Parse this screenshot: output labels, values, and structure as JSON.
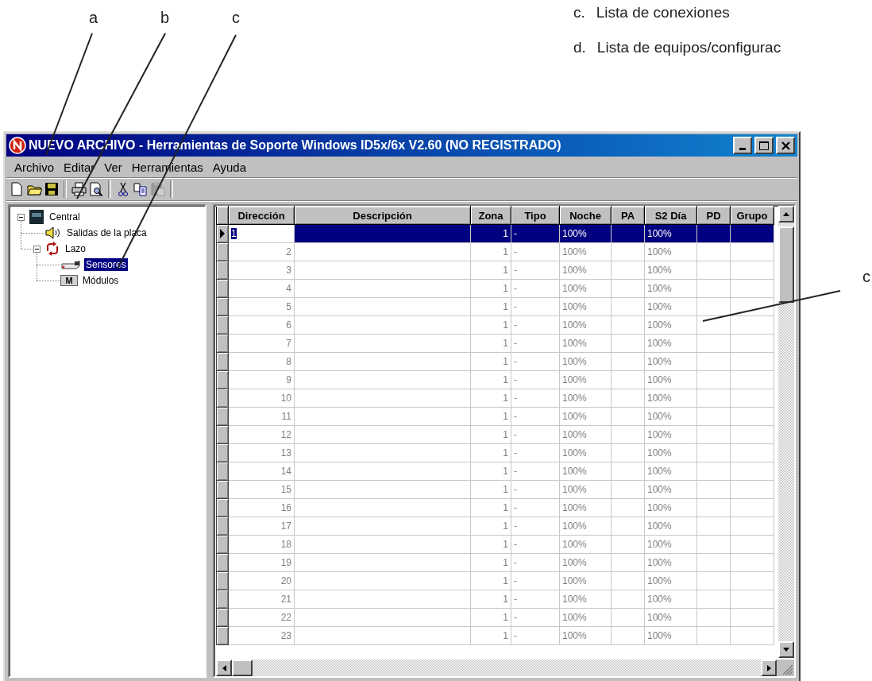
{
  "callouts": [
    {
      "letter": "a"
    },
    {
      "letter": "b"
    },
    {
      "letter": "c"
    }
  ],
  "legend": [
    {
      "letter": "c.",
      "text": "Lista de conexiones"
    },
    {
      "letter": "d.",
      "text": "Lista de equipos/configurac"
    }
  ],
  "side_callout": "c",
  "window": {
    "title": "NUEVO ARCHIVO - Herramientas de Soporte Windows ID5x/6x V2.60 (NO REGISTRADO)"
  },
  "menu": [
    "Archivo",
    "Editar",
    "Ver",
    "Herramientas",
    "Ayuda"
  ],
  "toolbar": [
    {
      "disabled": false
    },
    {
      "disabled": false
    },
    {
      "disabled": false
    },
    {
      "disabled": false
    },
    {
      "disabled": false
    },
    {
      "disabled": false
    },
    {
      "disabled": false
    },
    {
      "disabled": true
    }
  ],
  "tree": [
    {
      "label": "Central",
      "expanded": true,
      "selected": false,
      "children": [
        {
          "label": "Salidas de la placa",
          "selected": false
        },
        {
          "label": "Lazo",
          "expanded": true,
          "selected": false,
          "children": [
            {
              "label": "Sensores",
              "selected": true
            },
            {
              "label": "Módulos",
              "selected": false,
              "badge": "M"
            }
          ]
        }
      ]
    }
  ],
  "table": {
    "columns": [
      "Dirección",
      "Descripción",
      "Zona",
      "Tipo",
      "Noche",
      "PA",
      "S2 Día",
      "PD",
      "Grupo"
    ],
    "rows": [
      {
        "address": "1",
        "zona": "1",
        "tipo": "-",
        "noche": "100%",
        "s2_dia": "100%",
        "selected": true
      },
      {
        "address": "2",
        "zona": "1",
        "tipo": "-",
        "noche": "100%",
        "s2_dia": "100%",
        "selected": false
      },
      {
        "address": "3",
        "zona": "1",
        "tipo": "-",
        "noche": "100%",
        "s2_dia": "100%",
        "selected": false
      },
      {
        "address": "4",
        "zona": "1",
        "tipo": "-",
        "noche": "100%",
        "s2_dia": "100%",
        "selected": false
      },
      {
        "address": "5",
        "zona": "1",
        "tipo": "-",
        "noche": "100%",
        "s2_dia": "100%",
        "selected": false
      },
      {
        "address": "6",
        "zona": "1",
        "tipo": "-",
        "noche": "100%",
        "s2_dia": "100%",
        "selected": false
      },
      {
        "address": "7",
        "zona": "1",
        "tipo": "-",
        "noche": "100%",
        "s2_dia": "100%",
        "selected": false
      },
      {
        "address": "8",
        "zona": "1",
        "tipo": "-",
        "noche": "100%",
        "s2_dia": "100%",
        "selected": false
      },
      {
        "address": "9",
        "zona": "1",
        "tipo": "-",
        "noche": "100%",
        "s2_dia": "100%",
        "selected": false
      },
      {
        "address": "10",
        "zona": "1",
        "tipo": "-",
        "noche": "100%",
        "s2_dia": "100%",
        "selected": false
      },
      {
        "address": "11",
        "zona": "1",
        "tipo": "-",
        "noche": "100%",
        "s2_dia": "100%",
        "selected": false
      },
      {
        "address": "12",
        "zona": "1",
        "tipo": "-",
        "noche": "100%",
        "s2_dia": "100%",
        "selected": false
      },
      {
        "address": "13",
        "zona": "1",
        "tipo": "-",
        "noche": "100%",
        "s2_dia": "100%",
        "selected": false
      },
      {
        "address": "14",
        "zona": "1",
        "tipo": "-",
        "noche": "100%",
        "s2_dia": "100%",
        "selected": false
      },
      {
        "address": "15",
        "zona": "1",
        "tipo": "-",
        "noche": "100%",
        "s2_dia": "100%",
        "selected": false
      },
      {
        "address": "16",
        "zona": "1",
        "tipo": "-",
        "noche": "100%",
        "s2_dia": "100%",
        "selected": false
      },
      {
        "address": "17",
        "zona": "1",
        "tipo": "-",
        "noche": "100%",
        "s2_dia": "100%",
        "selected": false
      },
      {
        "address": "18",
        "zona": "1",
        "tipo": "-",
        "noche": "100%",
        "s2_dia": "100%",
        "selected": false
      },
      {
        "address": "19",
        "zona": "1",
        "tipo": "-",
        "noche": "100%",
        "s2_dia": "100%",
        "selected": false
      },
      {
        "address": "20",
        "zona": "1",
        "tipo": "-",
        "noche": "100%",
        "s2_dia": "100%",
        "selected": false
      },
      {
        "address": "21",
        "zona": "1",
        "tipo": "-",
        "noche": "100%",
        "s2_dia": "100%",
        "selected": false
      },
      {
        "address": "22",
        "zona": "1",
        "tipo": "-",
        "noche": "100%",
        "s2_dia": "100%",
        "selected": false
      },
      {
        "address": "23",
        "zona": "1",
        "tipo": "-",
        "noche": "100%",
        "s2_dia": "100%",
        "selected": false
      }
    ]
  }
}
